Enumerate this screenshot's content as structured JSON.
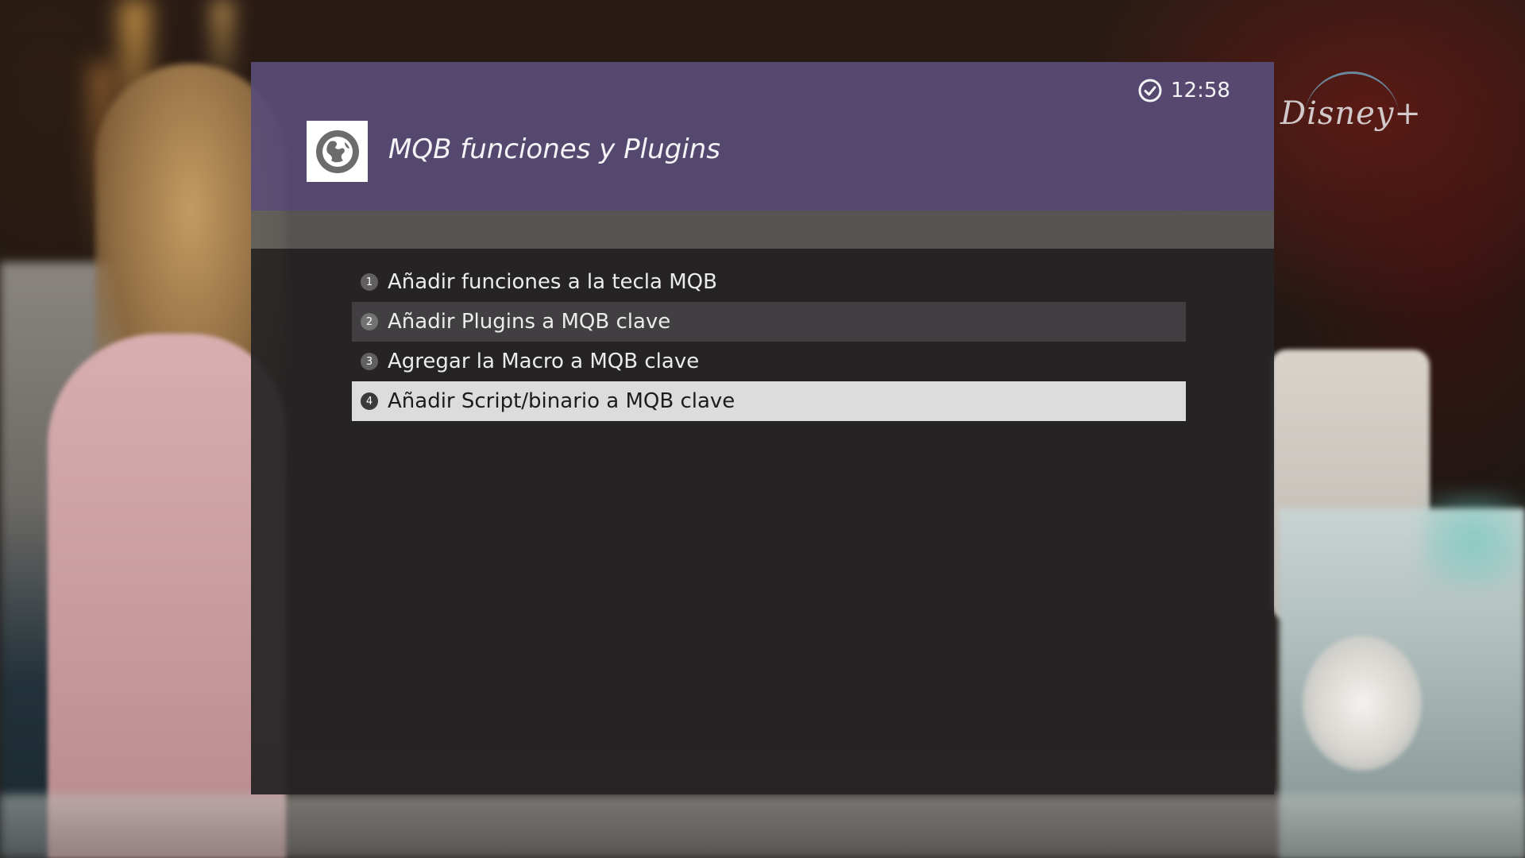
{
  "header": {
    "title": "MQB funciones y Plugins",
    "time": "12:58",
    "app_icon": "globe-icon",
    "clock_icon": "clock-icon"
  },
  "brand": {
    "logo_text": "Disney+"
  },
  "menu": {
    "items": [
      {
        "number": "1",
        "label": "Añadir funciones a la tecla MQB"
      },
      {
        "number": "2",
        "label": "Añadir Plugins a MQB clave"
      },
      {
        "number": "3",
        "label": "Agregar la Macro a MQB clave"
      },
      {
        "number": "4",
        "label": "Añadir Script/binario a MQB clave"
      }
    ],
    "selected_index": 3
  },
  "colors": {
    "header_bg": "#584c76",
    "subbar_bg": "#5c5c5c",
    "body_bg": "#262425",
    "selected_bg": "#dcdcdc"
  }
}
